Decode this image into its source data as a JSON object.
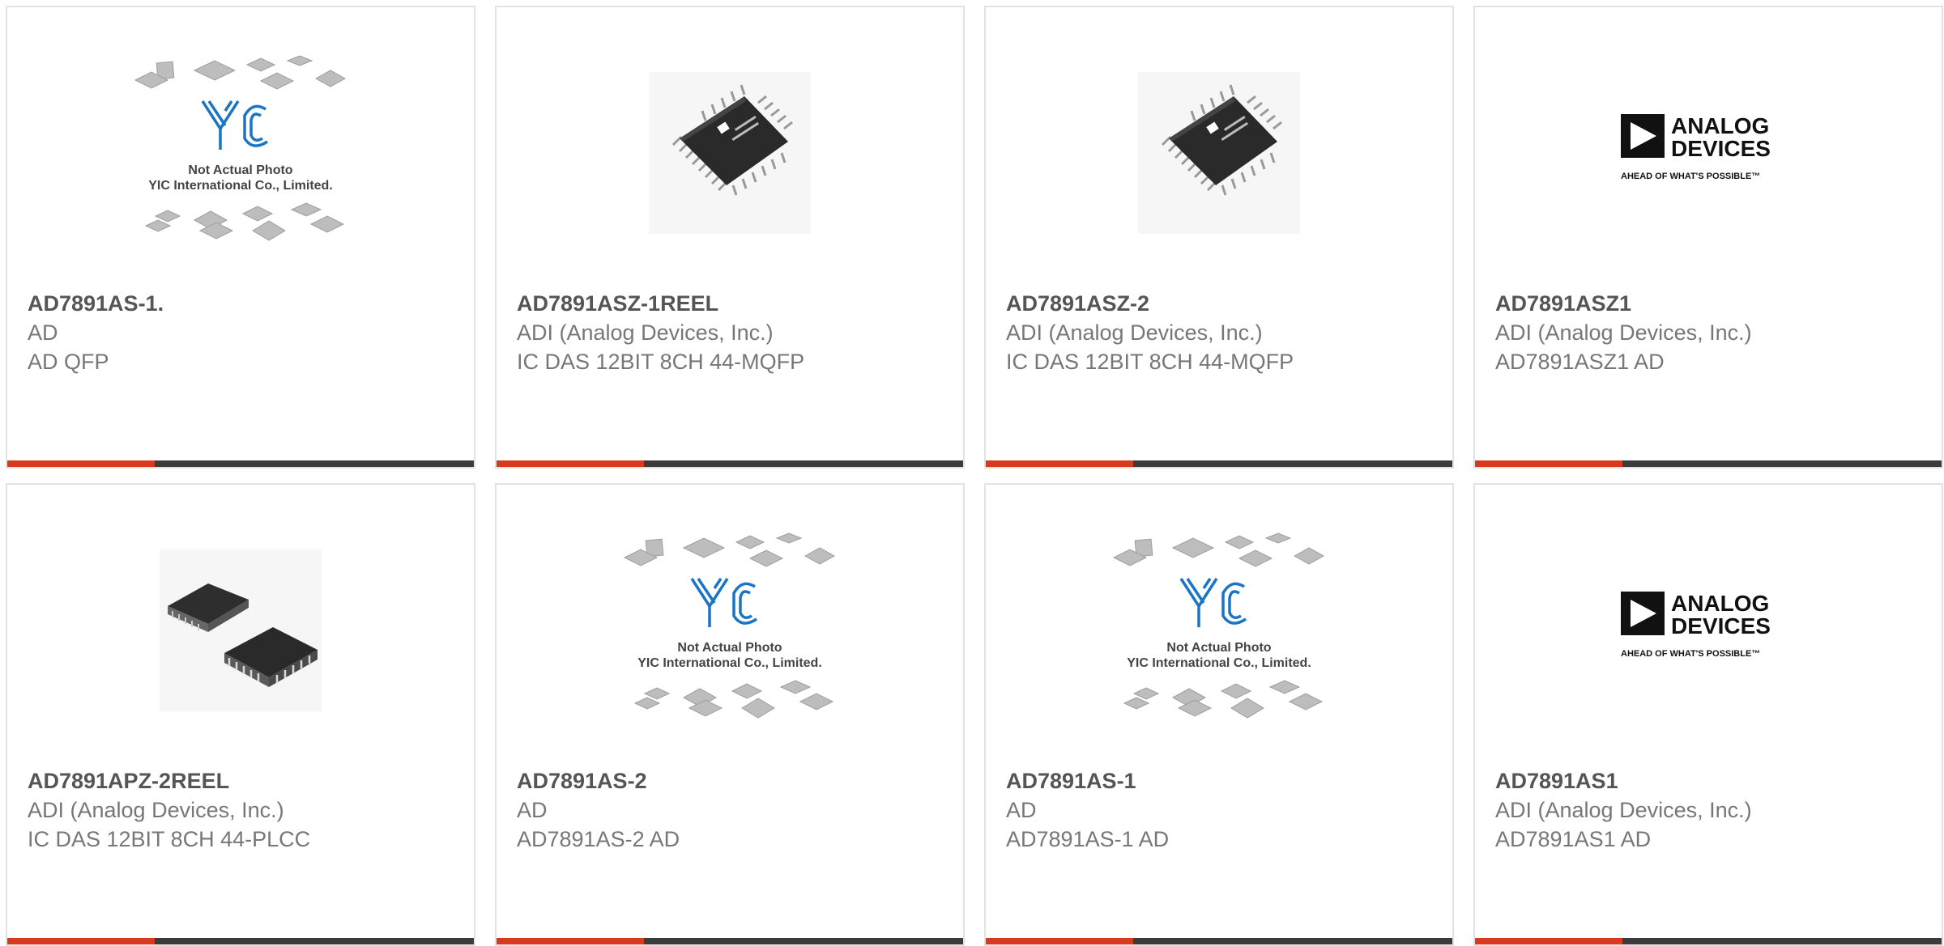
{
  "colors": {
    "accent": "#d83a1c",
    "bar": "#3b3b3b",
    "title": "#555555",
    "text": "#777777",
    "border": "#e2e2e2"
  },
  "cards": [
    {
      "pn": "AD7891AS-1.",
      "mfr": "AD",
      "desc": "AD QFP",
      "image": "placeholder"
    },
    {
      "pn": "AD7891ASZ-1REEL",
      "mfr": "ADI (Analog Devices, Inc.)",
      "desc": "IC DAS 12BIT 8CH 44-MQFP",
      "image": "qfp-chip"
    },
    {
      "pn": "AD7891ASZ-2",
      "mfr": "ADI (Analog Devices, Inc.)",
      "desc": "IC DAS 12BIT 8CH 44-MQFP",
      "image": "qfp-chip"
    },
    {
      "pn": "AD7891ASZ1",
      "mfr": "ADI (Analog Devices, Inc.)",
      "desc": "AD7891ASZ1 AD",
      "image": "adi-logo"
    },
    {
      "pn": "AD7891APZ-2REEL",
      "mfr": "ADI (Analog Devices, Inc.)",
      "desc": "IC DAS 12BIT 8CH 44-PLCC",
      "image": "plcc-chip"
    },
    {
      "pn": "AD7891AS-2",
      "mfr": "AD",
      "desc": "AD7891AS-2 AD",
      "image": "placeholder"
    },
    {
      "pn": "AD7891AS-1",
      "mfr": "AD",
      "desc": "AD7891AS-1 AD",
      "image": "placeholder"
    },
    {
      "pn": "AD7891AS1",
      "mfr": "ADI (Analog Devices, Inc.)",
      "desc": "AD7891AS1 AD",
      "image": "adi-logo"
    }
  ],
  "placeholder": {
    "logo": "YIC",
    "line1": "Not Actual Photo",
    "line2": "YIC International Co., Limited."
  },
  "adi_logo": {
    "line1": "ANALOG",
    "line2": "DEVICES",
    "tagline": "AHEAD OF WHAT'S POSSIBLE™"
  }
}
